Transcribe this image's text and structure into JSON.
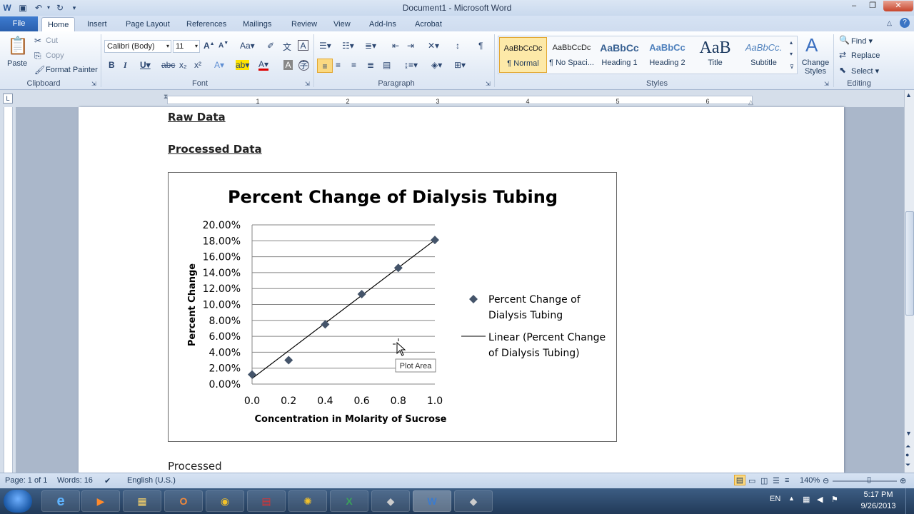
{
  "window": {
    "title": "Document1 - Microsoft Word"
  },
  "tabs": [
    "File",
    "Home",
    "Insert",
    "Page Layout",
    "References",
    "Mailings",
    "Review",
    "View",
    "Add-Ins",
    "Acrobat"
  ],
  "clipboard": {
    "paste": "Paste",
    "cut": "Cut",
    "copy": "Copy",
    "format_painter": "Format Painter",
    "group": "Clipboard"
  },
  "font": {
    "name": "Calibri (Body)",
    "size": "11",
    "group": "Font"
  },
  "paragraph": {
    "group": "Paragraph"
  },
  "styles": {
    "group": "Styles",
    "change_styles": "Change Styles",
    "items": [
      {
        "preview": "AaBbCcDc",
        "name": "¶ Normal"
      },
      {
        "preview": "AaBbCcDc",
        "name": "¶ No Spaci..."
      },
      {
        "preview": "AaBbCc",
        "name": "Heading 1"
      },
      {
        "preview": "AaBbCc",
        "name": "Heading 2"
      },
      {
        "preview": "AaB",
        "name": "Title"
      },
      {
        "preview": "AaBbCc.",
        "name": "Subtitle"
      }
    ]
  },
  "editing": {
    "find": "Find",
    "replace": "Replace",
    "select": "Select",
    "group": "Editing"
  },
  "document": {
    "heading1": "Raw Data",
    "heading2": "Processed Data",
    "body_text": "Processed Data"
  },
  "chart_data": {
    "type": "scatter",
    "title": "Percent Change of Dialysis Tubing",
    "xlabel": "Concentration in Molarity of Sucrose",
    "ylabel": "Percent Change",
    "xlim": [
      0.0,
      1.0
    ],
    "ylim": [
      0.0,
      20.0
    ],
    "x_ticks": [
      "0.0",
      "0.2",
      "0.4",
      "0.6",
      "0.8",
      "1.0"
    ],
    "y_ticks": [
      "0.00%",
      "2.00%",
      "4.00%",
      "6.00%",
      "8.00%",
      "10.00%",
      "12.00%",
      "14.00%",
      "16.00%",
      "18.00%",
      "20.00%"
    ],
    "series": [
      {
        "name": "Percent Change of Dialysis Tubing",
        "x": [
          0.0,
          0.2,
          0.4,
          0.6,
          0.8,
          1.0
        ],
        "y": [
          1.2,
          3.0,
          7.5,
          11.3,
          14.6,
          18.1
        ]
      }
    ],
    "trendline": {
      "name": "Linear (Percent Change of Dialysis Tubing)",
      "y0": 0.7,
      "y1": 18.1
    },
    "grid": true,
    "legend_position": "right",
    "marker_color": "#44546a",
    "tooltip": "Plot Area"
  },
  "status": {
    "page": "Page: 1 of 1",
    "words": "Words: 16",
    "language": "English (U.S.)",
    "zoom": "140%"
  },
  "taskbar": {
    "lang": "EN",
    "time": "5:17 PM",
    "date": "9/26/2013"
  }
}
